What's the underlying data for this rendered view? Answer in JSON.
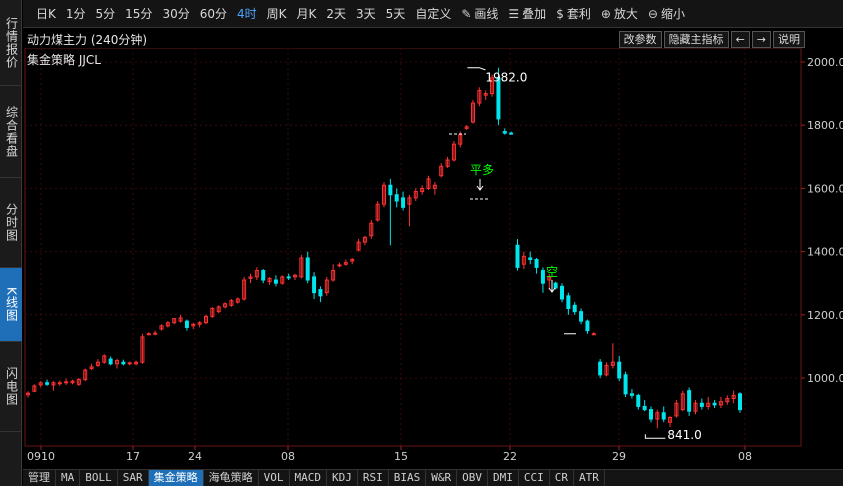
{
  "left_tabs": [
    {
      "label": "行情报价",
      "active": false
    },
    {
      "label": "综合看盘",
      "active": false
    },
    {
      "label": "分时图",
      "active": false
    },
    {
      "label": "K线图",
      "active": true
    },
    {
      "label": "闪电图",
      "active": false
    }
  ],
  "toolbar": {
    "periods": [
      {
        "label": "日K",
        "active": false
      },
      {
        "label": "1分",
        "active": false
      },
      {
        "label": "5分",
        "active": false
      },
      {
        "label": "15分",
        "active": false
      },
      {
        "label": "30分",
        "active": false
      },
      {
        "label": "60分",
        "active": false
      },
      {
        "label": "4时",
        "active": true
      },
      {
        "label": "周K",
        "active": false
      },
      {
        "label": "月K",
        "active": false
      },
      {
        "label": "2天",
        "active": false
      },
      {
        "label": "3天",
        "active": false
      },
      {
        "label": "5天",
        "active": false
      },
      {
        "label": "自定义",
        "active": false
      }
    ],
    "tools": [
      {
        "label": "画线",
        "icon": "pencil-icon"
      },
      {
        "label": "叠加",
        "icon": "stack-icon"
      },
      {
        "label": "套利",
        "icon": "arbitrage-icon"
      },
      {
        "label": "放大",
        "icon": "zoom-in-icon"
      },
      {
        "label": "缩小",
        "icon": "zoom-out-icon"
      }
    ]
  },
  "header": {
    "contract": "动力煤主力 (240分钟)",
    "strategy": "集金策略 JJCL",
    "buttons": {
      "params": "改参数",
      "hide": "隐藏主指标",
      "left": "←",
      "right": "→",
      "help": "说明"
    }
  },
  "bottom_tabs": [
    {
      "label": "管理",
      "active": false
    },
    {
      "label": "MA",
      "active": false
    },
    {
      "label": "BOLL",
      "active": false
    },
    {
      "label": "SAR",
      "active": false
    },
    {
      "label": "集金策略",
      "active": true
    },
    {
      "label": "海龟策略",
      "active": false
    },
    {
      "label": "VOL",
      "active": false
    },
    {
      "label": "MACD",
      "active": false
    },
    {
      "label": "KDJ",
      "active": false
    },
    {
      "label": "RSI",
      "active": false
    },
    {
      "label": "BIAS",
      "active": false
    },
    {
      "label": "W&R",
      "active": false
    },
    {
      "label": "OBV",
      "active": false
    },
    {
      "label": "DMI",
      "active": false
    },
    {
      "label": "CCI",
      "active": false
    },
    {
      "label": "CR",
      "active": false
    },
    {
      "label": "ATR",
      "active": false
    }
  ],
  "chart_data": {
    "type": "candlestick",
    "y_ticks": [
      "2000.0",
      "1800.0",
      "1600.0",
      "1400.0",
      "1200.0",
      "1000.0"
    ],
    "ylim": [
      840,
      2000
    ],
    "x_labels": [
      "0910",
      "17",
      "24",
      "08",
      "15",
      "22",
      "29",
      "08"
    ],
    "annotations": {
      "high_label": "1982.0",
      "low_label": "841.0",
      "close_long": "平多",
      "short": "空"
    },
    "colors": {
      "up": "#ff3232",
      "down": "#00e5ee",
      "grid": "#3a0a0a",
      "signal": "#00ff00",
      "axis_text": "#cfcfcf"
    },
    "candles": [
      {
        "o": 947,
        "h": 958,
        "l": 938,
        "c": 952
      },
      {
        "o": 958,
        "h": 980,
        "l": 955,
        "c": 975
      },
      {
        "o": 978,
        "h": 990,
        "l": 970,
        "c": 985
      },
      {
        "o": 985,
        "h": 995,
        "l": 975,
        "c": 980
      },
      {
        "o": 978,
        "h": 990,
        "l": 960,
        "c": 985
      },
      {
        "o": 982,
        "h": 992,
        "l": 975,
        "c": 985
      },
      {
        "o": 985,
        "h": 998,
        "l": 978,
        "c": 988
      },
      {
        "o": 985,
        "h": 995,
        "l": 980,
        "c": 990
      },
      {
        "o": 980,
        "h": 1000,
        "l": 975,
        "c": 995
      },
      {
        "o": 995,
        "h": 1030,
        "l": 990,
        "c": 1025
      },
      {
        "o": 1030,
        "h": 1045,
        "l": 1025,
        "c": 1035
      },
      {
        "o": 1040,
        "h": 1060,
        "l": 1035,
        "c": 1050
      },
      {
        "o": 1050,
        "h": 1075,
        "l": 1045,
        "c": 1070
      },
      {
        "o": 1060,
        "h": 1068,
        "l": 1040,
        "c": 1045
      },
      {
        "o": 1045,
        "h": 1060,
        "l": 1030,
        "c": 1055
      },
      {
        "o": 1050,
        "h": 1058,
        "l": 1040,
        "c": 1045
      },
      {
        "o": 1045,
        "h": 1052,
        "l": 1040,
        "c": 1048
      },
      {
        "o": 1045,
        "h": 1055,
        "l": 1040,
        "c": 1050
      },
      {
        "o": 1050,
        "h": 1140,
        "l": 1045,
        "c": 1130
      },
      {
        "o": 1140,
        "h": 1145,
        "l": 1135,
        "c": 1140
      },
      {
        "o": 1140,
        "h": 1150,
        "l": 1135,
        "c": 1142
      },
      {
        "o": 1155,
        "h": 1170,
        "l": 1150,
        "c": 1165
      },
      {
        "o": 1165,
        "h": 1180,
        "l": 1160,
        "c": 1175
      },
      {
        "o": 1175,
        "h": 1190,
        "l": 1170,
        "c": 1188
      },
      {
        "o": 1180,
        "h": 1200,
        "l": 1175,
        "c": 1190
      },
      {
        "o": 1180,
        "h": 1185,
        "l": 1150,
        "c": 1160
      },
      {
        "o": 1165,
        "h": 1175,
        "l": 1155,
        "c": 1170
      },
      {
        "o": 1170,
        "h": 1180,
        "l": 1160,
        "c": 1175
      },
      {
        "o": 1175,
        "h": 1200,
        "l": 1170,
        "c": 1195
      },
      {
        "o": 1195,
        "h": 1225,
        "l": 1190,
        "c": 1220
      },
      {
        "o": 1210,
        "h": 1230,
        "l": 1205,
        "c": 1225
      },
      {
        "o": 1225,
        "h": 1240,
        "l": 1220,
        "c": 1235
      },
      {
        "o": 1230,
        "h": 1250,
        "l": 1225,
        "c": 1245
      },
      {
        "o": 1240,
        "h": 1255,
        "l": 1235,
        "c": 1250
      },
      {
        "o": 1250,
        "h": 1320,
        "l": 1245,
        "c": 1310
      },
      {
        "o": 1315,
        "h": 1330,
        "l": 1300,
        "c": 1320
      },
      {
        "o": 1320,
        "h": 1350,
        "l": 1310,
        "c": 1340
      },
      {
        "o": 1340,
        "h": 1345,
        "l": 1300,
        "c": 1310
      },
      {
        "o": 1305,
        "h": 1320,
        "l": 1295,
        "c": 1315
      },
      {
        "o": 1310,
        "h": 1325,
        "l": 1290,
        "c": 1300
      },
      {
        "o": 1300,
        "h": 1325,
        "l": 1295,
        "c": 1320
      },
      {
        "o": 1320,
        "h": 1330,
        "l": 1310,
        "c": 1318
      },
      {
        "o": 1320,
        "h": 1330,
        "l": 1310,
        "c": 1325
      },
      {
        "o": 1320,
        "h": 1390,
        "l": 1315,
        "c": 1380
      },
      {
        "o": 1380,
        "h": 1400,
        "l": 1300,
        "c": 1310
      },
      {
        "o": 1320,
        "h": 1335,
        "l": 1250,
        "c": 1270
      },
      {
        "o": 1280,
        "h": 1290,
        "l": 1240,
        "c": 1260
      },
      {
        "o": 1270,
        "h": 1320,
        "l": 1260,
        "c": 1310
      },
      {
        "o": 1310,
        "h": 1360,
        "l": 1305,
        "c": 1340
      },
      {
        "o": 1355,
        "h": 1365,
        "l": 1350,
        "c": 1358
      },
      {
        "o": 1360,
        "h": 1375,
        "l": 1355,
        "c": 1365
      },
      {
        "o": 1370,
        "h": 1380,
        "l": 1360,
        "c": 1375
      },
      {
        "o": 1405,
        "h": 1440,
        "l": 1400,
        "c": 1430
      },
      {
        "o": 1430,
        "h": 1450,
        "l": 1420,
        "c": 1445
      },
      {
        "o": 1450,
        "h": 1500,
        "l": 1440,
        "c": 1490
      },
      {
        "o": 1500,
        "h": 1560,
        "l": 1495,
        "c": 1550
      },
      {
        "o": 1550,
        "h": 1620,
        "l": 1540,
        "c": 1610
      },
      {
        "o": 1610,
        "h": 1630,
        "l": 1420,
        "c": 1580
      },
      {
        "o": 1580,
        "h": 1600,
        "l": 1540,
        "c": 1560
      },
      {
        "o": 1570,
        "h": 1590,
        "l": 1530,
        "c": 1540
      },
      {
        "o": 1550,
        "h": 1580,
        "l": 1480,
        "c": 1570
      },
      {
        "o": 1570,
        "h": 1600,
        "l": 1560,
        "c": 1590
      },
      {
        "o": 1590,
        "h": 1610,
        "l": 1580,
        "c": 1600
      },
      {
        "o": 1600,
        "h": 1640,
        "l": 1595,
        "c": 1630
      },
      {
        "o": 1600,
        "h": 1620,
        "l": 1580,
        "c": 1610
      },
      {
        "o": 1640,
        "h": 1680,
        "l": 1635,
        "c": 1670
      },
      {
        "o": 1670,
        "h": 1700,
        "l": 1665,
        "c": 1690
      },
      {
        "o": 1690,
        "h": 1750,
        "l": 1685,
        "c": 1740
      },
      {
        "o": 1740,
        "h": 1780,
        "l": 1730,
        "c": 1770
      },
      {
        "o": 1790,
        "h": 1800,
        "l": 1785,
        "c": 1795
      },
      {
        "o": 1810,
        "h": 1880,
        "l": 1805,
        "c": 1870
      },
      {
        "o": 1870,
        "h": 1920,
        "l": 1860,
        "c": 1910
      },
      {
        "o": 1895,
        "h": 1910,
        "l": 1880,
        "c": 1900
      },
      {
        "o": 1900,
        "h": 1960,
        "l": 1890,
        "c": 1950
      },
      {
        "o": 1950,
        "h": 1982,
        "l": 1800,
        "c": 1820
      },
      {
        "o": 1780,
        "h": 1790,
        "l": 1770,
        "c": 1775
      },
      {
        "o": 1775,
        "h": 1780,
        "l": 1770,
        "c": 1772
      },
      {
        "o": 1420,
        "h": 1440,
        "l": 1340,
        "c": 1350
      },
      {
        "o": 1360,
        "h": 1400,
        "l": 1345,
        "c": 1385
      },
      {
        "o": 1380,
        "h": 1400,
        "l": 1360,
        "c": 1375
      },
      {
        "o": 1375,
        "h": 1380,
        "l": 1330,
        "c": 1350
      },
      {
        "o": 1340,
        "h": 1350,
        "l": 1270,
        "c": 1300
      },
      {
        "o": 1310,
        "h": 1330,
        "l": 1280,
        "c": 1320
      },
      {
        "o": 1300,
        "h": 1305,
        "l": 1280,
        "c": 1285
      },
      {
        "o": 1290,
        "h": 1300,
        "l": 1240,
        "c": 1250
      },
      {
        "o": 1260,
        "h": 1270,
        "l": 1200,
        "c": 1220
      },
      {
        "o": 1230,
        "h": 1240,
        "l": 1200,
        "c": 1210
      },
      {
        "o": 1210,
        "h": 1220,
        "l": 1170,
        "c": 1180
      },
      {
        "o": 1180,
        "h": 1185,
        "l": 1140,
        "c": 1150
      },
      {
        "o": 1140,
        "h": 1145,
        "l": 1136,
        "c": 1140
      },
      {
        "o": 1050,
        "h": 1060,
        "l": 1000,
        "c": 1010
      },
      {
        "o": 1010,
        "h": 1050,
        "l": 1005,
        "c": 1040
      },
      {
        "o": 1040,
        "h": 1110,
        "l": 1030,
        "c": 1050
      },
      {
        "o": 1050,
        "h": 1070,
        "l": 990,
        "c": 1000
      },
      {
        "o": 1010,
        "h": 1020,
        "l": 940,
        "c": 950
      },
      {
        "o": 950,
        "h": 965,
        "l": 935,
        "c": 945
      },
      {
        "o": 945,
        "h": 950,
        "l": 900,
        "c": 910
      },
      {
        "o": 910,
        "h": 930,
        "l": 895,
        "c": 900
      },
      {
        "o": 900,
        "h": 910,
        "l": 860,
        "c": 870
      },
      {
        "o": 870,
        "h": 900,
        "l": 841,
        "c": 890
      },
      {
        "o": 890,
        "h": 910,
        "l": 860,
        "c": 870
      },
      {
        "o": 860,
        "h": 880,
        "l": 845,
        "c": 875
      },
      {
        "o": 880,
        "h": 930,
        "l": 875,
        "c": 920
      },
      {
        "o": 900,
        "h": 960,
        "l": 895,
        "c": 950
      },
      {
        "o": 960,
        "h": 970,
        "l": 880,
        "c": 895
      },
      {
        "o": 895,
        "h": 930,
        "l": 885,
        "c": 920
      },
      {
        "o": 920,
        "h": 935,
        "l": 900,
        "c": 910
      },
      {
        "o": 910,
        "h": 940,
        "l": 900,
        "c": 920
      },
      {
        "o": 920,
        "h": 930,
        "l": 905,
        "c": 915
      },
      {
        "o": 915,
        "h": 940,
        "l": 905,
        "c": 925
      },
      {
        "o": 925,
        "h": 945,
        "l": 915,
        "c": 935
      },
      {
        "o": 935,
        "h": 960,
        "l": 920,
        "c": 945
      },
      {
        "o": 950,
        "h": 955,
        "l": 890,
        "c": 900
      }
    ]
  }
}
